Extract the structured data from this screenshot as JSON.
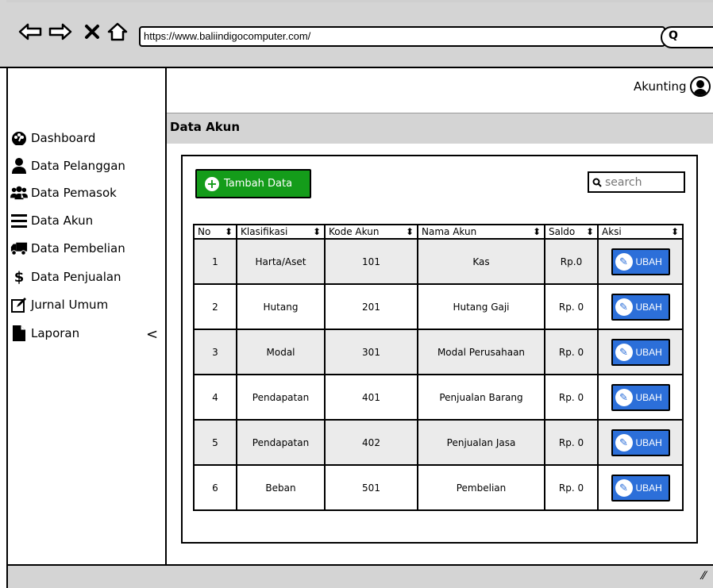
{
  "browser": {
    "url": "https://www.baliindigocomputer.com/",
    "search_icon_glyph": "Q"
  },
  "header": {
    "user_label": "Akunting"
  },
  "sidebar": {
    "items": [
      {
        "label": "Dashboard",
        "icon": "dashboard-icon"
      },
      {
        "label": "Data Pelanggan",
        "icon": "user-icon"
      },
      {
        "label": "Data Pemasok",
        "icon": "users-icon"
      },
      {
        "label": "Data Akun",
        "icon": "list-icon"
      },
      {
        "label": "Data Pembelian",
        "icon": "truck-icon"
      },
      {
        "label": "Data Penjualan",
        "icon": "dollar-icon"
      },
      {
        "label": "Jurnal Umum",
        "icon": "edit-icon"
      },
      {
        "label": "Laporan",
        "icon": "file-icon"
      }
    ],
    "chevron": "<"
  },
  "page": {
    "title": "Data Akun",
    "add_button": "Tambah Data",
    "search_placeholder": "search"
  },
  "table": {
    "headers": [
      "No",
      "Klasifikasi",
      "Kode Akun",
      "Nama Akun",
      "Saldo",
      "Aksi"
    ],
    "rows": [
      {
        "no": "1",
        "klasifikasi": "Harta/Aset",
        "kode": "101",
        "nama": "Kas",
        "saldo": "Rp.0",
        "aksi": "UBAH"
      },
      {
        "no": "2",
        "klasifikasi": "Hutang",
        "kode": "201",
        "nama": "Hutang Gaji",
        "saldo": "Rp. 0",
        "aksi": "UBAH"
      },
      {
        "no": "3",
        "klasifikasi": "Modal",
        "kode": "301",
        "nama": "Modal Perusahaan",
        "saldo": "Rp. 0",
        "aksi": "UBAH"
      },
      {
        "no": "4",
        "klasifikasi": "Pendapatan",
        "kode": "401",
        "nama": "Penjualan Barang",
        "saldo": "Rp. 0",
        "aksi": "UBAH"
      },
      {
        "no": "5",
        "klasifikasi": "Pendapatan",
        "kode": "402",
        "nama": "Penjualan Jasa",
        "saldo": "Rp. 0",
        "aksi": "UBAH"
      },
      {
        "no": "6",
        "klasifikasi": "Beban",
        "kode": "501",
        "nama": "Pembelian",
        "saldo": "Rp. 0",
        "aksi": "UBAH"
      }
    ]
  },
  "colors": {
    "add_button": "#149c1a",
    "edit_button": "#2c6fd9",
    "chrome_gray": "#d4d4d4"
  }
}
